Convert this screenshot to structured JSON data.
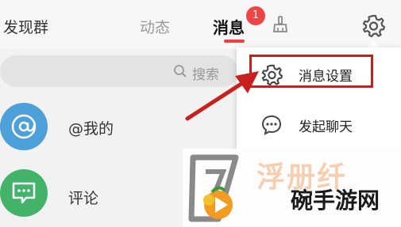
{
  "topbar": {
    "left_title": "发现群",
    "tabs": [
      {
        "label": "动态"
      },
      {
        "label": "消息",
        "badge": "1"
      }
    ]
  },
  "search": {
    "placeholder": "搜索"
  },
  "list": [
    {
      "label": "@我的",
      "avatar_icon": "at-icon",
      "color": "#4da0d8"
    },
    {
      "label": "评论",
      "avatar_icon": "comment-icon",
      "color": "#43b36a"
    }
  ],
  "menu": {
    "items": [
      {
        "label": "消息设置",
        "icon": "gear-icon"
      },
      {
        "label": "发起聊天",
        "icon": "chat-icon"
      }
    ]
  },
  "annotation": {
    "color": "#c8201c"
  },
  "watermark": {
    "text": "碗手游网",
    "top_text": "浮册纤"
  },
  "colors": {
    "accent": "#ef3f3f",
    "badge": "#ef4444"
  }
}
